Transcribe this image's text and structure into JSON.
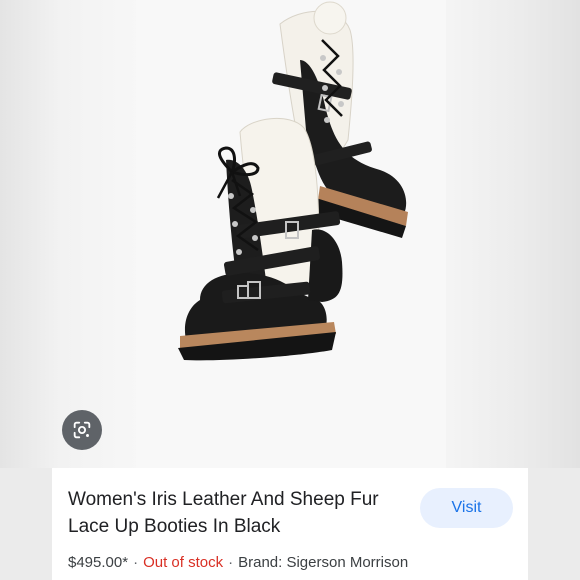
{
  "product": {
    "title": "Women's Iris Leather And Sheep Fur Lace Up Booties In Black",
    "price": "$495.00*",
    "separator": "·",
    "stock_status": "Out of stock",
    "brand": "Brand: Sigerson Morrison"
  },
  "actions": {
    "visit_label": "Visit",
    "lens_icon": "google-lens-icon"
  },
  "colors": {
    "out_of_stock": "#d93025",
    "visit_bg": "#e8f0fe",
    "visit_text": "#1a73e8",
    "lens_bg": "#5f6368"
  }
}
